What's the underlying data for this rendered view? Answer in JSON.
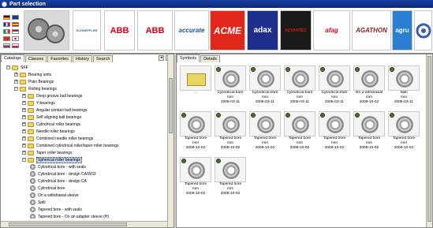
{
  "window": {
    "title": "Part selection"
  },
  "logos": [
    {
      "text": "",
      "color": "#666666"
    },
    {
      "text": "SCHAEFFLER",
      "color": "#2a62a8"
    },
    {
      "text": "ABB",
      "color": "#e2001a"
    },
    {
      "text": "ABB",
      "color": "#e2001a"
    },
    {
      "text": "accurate",
      "color": "#1e4f9c"
    },
    {
      "text": "ACME",
      "color": "#ffffff"
    },
    {
      "text": "adax",
      "color": "#ffffff"
    },
    {
      "text": "ADVANTEC",
      "color": "#d01818"
    },
    {
      "text": "afag",
      "color": "#e2001a"
    },
    {
      "text": "AGATHON",
      "color": "#8a1c1c"
    },
    {
      "text": "agru",
      "color": "#ffffff"
    },
    {
      "text": "",
      "color": "#3a5ea8"
    }
  ],
  "left_pane": {
    "tabs": [
      "Catalogs",
      "Classes",
      "Favorites",
      "History",
      "Search"
    ],
    "tree": [
      {
        "label": "SKF",
        "level": 0,
        "icon": "folder",
        "expanded": true
      },
      {
        "label": "Bearing units",
        "level": 1,
        "icon": "folder",
        "expanded": false
      },
      {
        "label": "Plain Bearings",
        "level": 1,
        "icon": "folder",
        "expanded": false
      },
      {
        "label": "Rolling bearings",
        "level": 1,
        "icon": "folder",
        "expanded": true
      },
      {
        "label": "Deep groove ball bearings",
        "level": 2,
        "icon": "folder",
        "expanded": false
      },
      {
        "label": "Y-bearings",
        "level": 2,
        "icon": "folder",
        "expanded": false
      },
      {
        "label": "Angular contact ball bearings",
        "level": 2,
        "icon": "folder",
        "expanded": false
      },
      {
        "label": "Self aligning ball bearings",
        "level": 2,
        "icon": "folder",
        "expanded": false
      },
      {
        "label": "Cylindrical roller bearings",
        "level": 2,
        "icon": "folder",
        "expanded": false
      },
      {
        "label": "Needle roller bearings",
        "level": 2,
        "icon": "folder",
        "expanded": false
      },
      {
        "label": "Combined needle roller bearings",
        "level": 2,
        "icon": "folder",
        "expanded": false
      },
      {
        "label": "Combined cylindrical roller/taper roller bearings",
        "level": 2,
        "icon": "folder",
        "expanded": false
      },
      {
        "label": "Taper roller bearings",
        "level": 2,
        "icon": "folder",
        "expanded": false
      },
      {
        "label": "Spherical roller bearings",
        "level": 2,
        "icon": "folder",
        "expanded": true,
        "selected": true
      },
      {
        "label": "Cylindrical bore   -  with seals",
        "level": 3,
        "icon": "part"
      },
      {
        "label": "Cylindrical bore  -  design CA/W33",
        "level": 3,
        "icon": "part"
      },
      {
        "label": "Cylindrical bore  -  design CA",
        "level": 3,
        "icon": "part"
      },
      {
        "label": "Cylindrical bore",
        "level": 3,
        "icon": "part"
      },
      {
        "label": "On a withdrawal sleeve",
        "level": 3,
        "icon": "part"
      },
      {
        "label": "Split",
        "level": 3,
        "icon": "part"
      },
      {
        "label": "Tapered bore  -  with seals",
        "level": 3,
        "icon": "part"
      },
      {
        "label": "Tapered bore  -  On an adapter sleeve (H)",
        "level": 3,
        "icon": "part"
      }
    ]
  },
  "right_pane": {
    "tabs": [
      "Symbols",
      "Details"
    ],
    "tiles": [
      {
        "icon": "folder",
        "line1": "..",
        "line2": "",
        "line3": ""
      },
      {
        "icon": "bearing",
        "line1": "Cylindrical bore",
        "line2": "mm",
        "line3": "2008-03-11"
      },
      {
        "icon": "bearing",
        "line1": "Cylindrical bore",
        "line2": "mm",
        "line3": "2008-03-11"
      },
      {
        "icon": "bearing",
        "line1": "Cylindrical bore",
        "line2": "mm",
        "line3": "2008-03-11"
      },
      {
        "icon": "bearing",
        "line1": "Cylindrical bore",
        "line2": "mm",
        "line3": "2008-03-11"
      },
      {
        "icon": "bearing",
        "line1": "On a withdrawal",
        "line2": "mm",
        "line3": "2008-10-02"
      },
      {
        "icon": "bearing",
        "line1": "Split",
        "line2": "mm",
        "line3": "2008-03-11"
      },
      {
        "icon": "bearing",
        "line1": "Tapered bore",
        "line2": "mm",
        "line3": "2008-10-02"
      },
      {
        "icon": "bearing",
        "line1": "Tapered bore",
        "line2": "mm",
        "line3": "2008-10-02"
      },
      {
        "icon": "bearing",
        "line1": "Tapered bore",
        "line2": "mm",
        "line3": "2008-10-02"
      },
      {
        "icon": "bearing",
        "line1": "Tapered bore",
        "line2": "mm",
        "line3": "2008-10-02"
      },
      {
        "icon": "bearing",
        "line1": "Tapered bore",
        "line2": "mm",
        "line3": "2008-10-02"
      },
      {
        "icon": "bearing",
        "line1": "Tapered bore",
        "line2": "mm",
        "line3": "2008-10-02"
      },
      {
        "icon": "bearing",
        "line1": "Tapered bore",
        "line2": "mm",
        "line3": "2008-10-02"
      },
      {
        "icon": "bearing",
        "line1": "Tapered bore",
        "line2": "mm",
        "line3": "2008-10-02"
      },
      {
        "icon": "bearing",
        "line1": "Tapered bore",
        "line2": "mm",
        "line3": "2008-10-02"
      }
    ]
  }
}
